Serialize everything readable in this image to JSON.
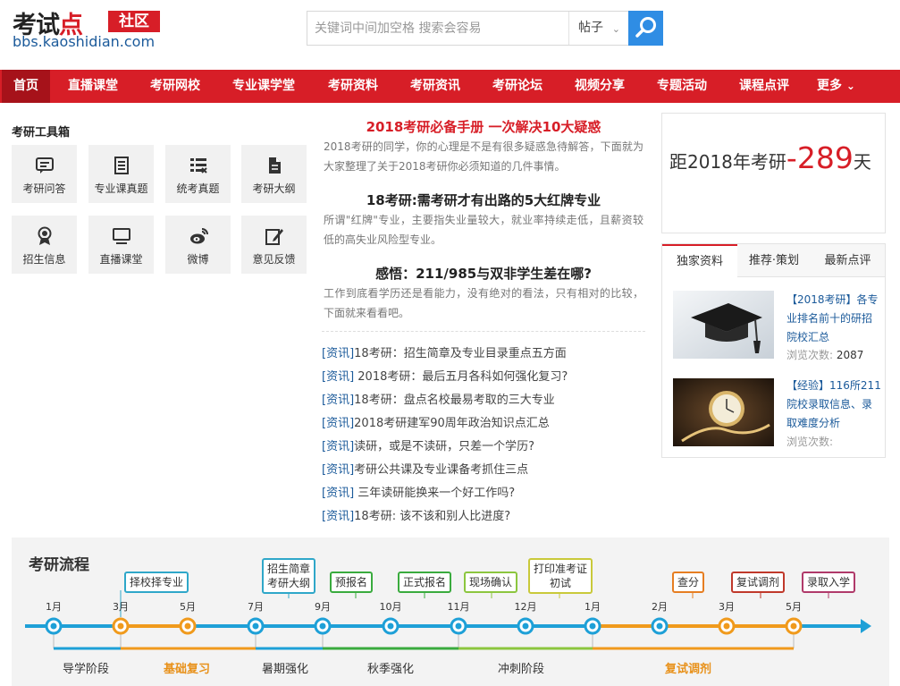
{
  "header": {
    "logo_text_1": "考试",
    "logo_text_2": "点",
    "logo_badge": "社区",
    "logo_url": "bbs.kaoshidian.com",
    "search_placeholder": "关键词中间加空格 搜索会容易",
    "search_type": "帖子",
    "search_icon": "search-icon"
  },
  "nav": {
    "items": [
      "首页",
      "直播课堂",
      "考研网校",
      "专业课学堂",
      "考研资料",
      "考研资讯",
      "考研论坛",
      "视频分享",
      "专题活动",
      "课程点评",
      "更多"
    ],
    "active": "首页"
  },
  "toolbox": {
    "title": "考研工具箱",
    "tools": [
      {
        "label": "考研问答",
        "icon": "chat-icon"
      },
      {
        "label": "专业课真题",
        "icon": "document-icon"
      },
      {
        "label": "统考真题",
        "icon": "list-icon"
      },
      {
        "label": "考研大纲",
        "icon": "file-icon"
      },
      {
        "label": "招生信息",
        "icon": "medal-icon"
      },
      {
        "label": "直播课堂",
        "icon": "monitor-icon"
      },
      {
        "label": "微博",
        "icon": "weibo-icon"
      },
      {
        "label": "意见反馈",
        "icon": "edit-icon"
      }
    ]
  },
  "features": [
    {
      "title": "2018考研必备手册 一次解决10大疑惑",
      "desc": "2018考研的同学，你的心理是不是有很多疑惑急待解答，下面就为大家整理了关于2018考研你必须知道的几件事情。"
    },
    {
      "title": "18考研:需考研才有出路的5大红牌专业",
      "desc": "所谓\"红牌\"专业，主要指失业量较大，就业率持续走低，且薪资较低的高失业风险型专业。"
    },
    {
      "title": "感悟：211/985与双非学生差在哪?",
      "desc": "工作到底看学历还是看能力，没有绝对的看法，只有相对的比较，下面就来看看吧。"
    }
  ],
  "news": [
    {
      "tag": "[资讯]",
      "text": "18考研：招生简章及专业目录重点五方面"
    },
    {
      "tag": "[资讯]",
      "text": " 2018考研：最后五月各科如何强化复习?"
    },
    {
      "tag": "[资讯]",
      "text": "18考研：盘点名校最易考取的三大专业"
    },
    {
      "tag": "[资讯]",
      "text": "2018考研建军90周年政治知识点汇总"
    },
    {
      "tag": "[资讯]",
      "text": "读研，或是不读研，只差一个学历?"
    },
    {
      "tag": "[资讯]",
      "text": "考研公共课及专业课备考抓住三点"
    },
    {
      "tag": "[资讯]",
      "text": " 三年读研能换来一个好工作吗?"
    },
    {
      "tag": "[资讯]",
      "text": "18考研: 该不该和别人比进度?"
    }
  ],
  "countdown": {
    "prefix": "距2018年考研",
    "dash": "-",
    "days": "289",
    "suffix": "天"
  },
  "panel": {
    "tabs": [
      "独家资料",
      "推荐·策划",
      "最新点评"
    ],
    "active_tab": "独家资料",
    "items": [
      {
        "tag": "【2018考研】",
        "text": "各专业排名前十的研招院校汇总",
        "views_label": "浏览次数:",
        "views": "2087"
      },
      {
        "tag": "【经验】",
        "text": "116所211院校录取信息、录取难度分析",
        "views_label": "浏览次数:",
        "views": ""
      }
    ]
  },
  "process": {
    "title": "考研流程",
    "months": [
      "1月",
      "3月",
      "5月",
      "7月",
      "9月",
      "10月",
      "11月",
      "12月",
      "1月",
      "2月",
      "3月",
      "5月"
    ],
    "events": [
      {
        "label": "择校择专业",
        "color": "#2fa7c9"
      },
      {
        "label": "招生简章\n考研大纲",
        "color": "#2fa7c9"
      },
      {
        "label": "预报名",
        "color": "#3aab3e"
      },
      {
        "label": "正式报名",
        "color": "#3aab3e"
      },
      {
        "label": "现场确认",
        "color": "#8cc63f"
      },
      {
        "label": "打印准考证\n初试",
        "color": "#c9c93a"
      },
      {
        "label": "查分",
        "color": "#e67e22"
      },
      {
        "label": "复试调剂",
        "color": "#c0392b"
      },
      {
        "label": "录取入学",
        "color": "#b03a6a"
      }
    ],
    "stages": [
      "导学阶段",
      "基础复习",
      "暑期强化",
      "秋季强化",
      "冲刺阶段",
      "复试调剂"
    ]
  },
  "colors": {
    "brand_red": "#d71e27",
    "link_blue": "#1b5a9a",
    "timeline_blue": "#1ea0d7",
    "timeline_orange": "#f09a1c"
  }
}
